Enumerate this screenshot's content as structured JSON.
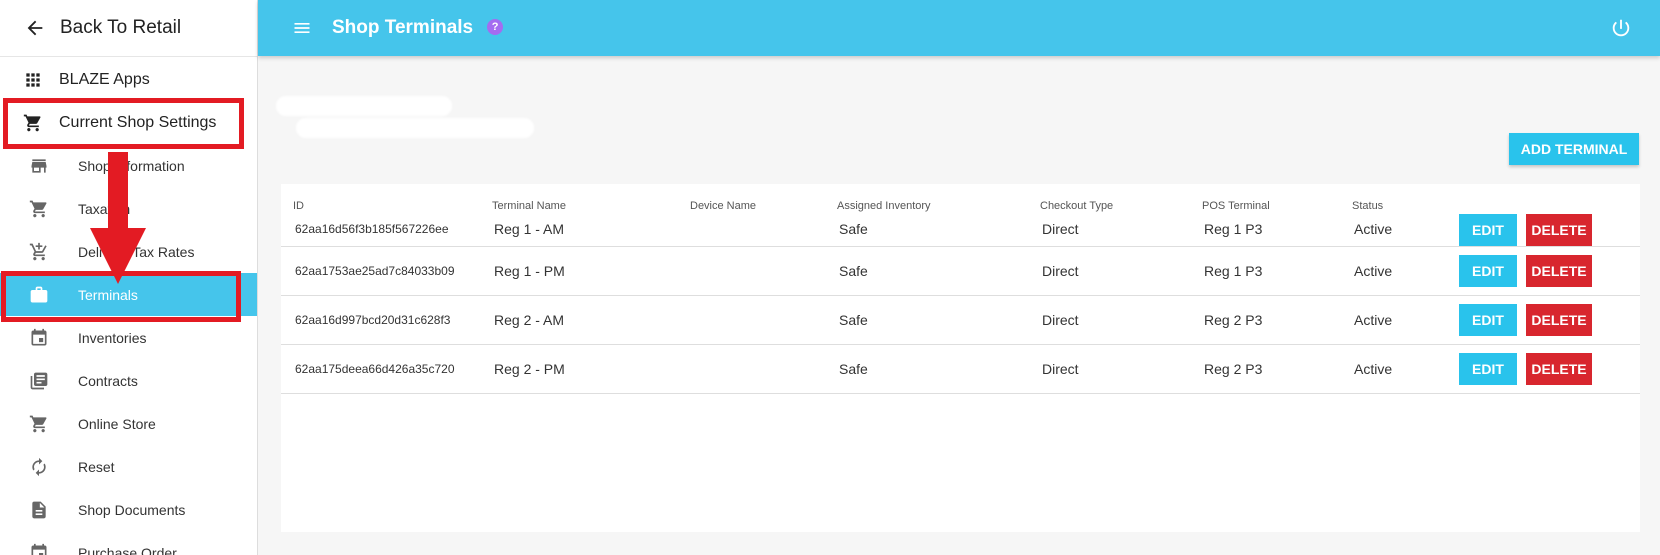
{
  "sidebar": {
    "back_label": "Back To Retail",
    "apps_label": "BLAZE Apps",
    "settings_label": "Current Shop Settings",
    "items": [
      {
        "label": "Shop Information",
        "icon": "store-icon"
      },
      {
        "label": "Taxation",
        "icon": "cart-icon"
      },
      {
        "label": "Delivery Tax Rates",
        "icon": "cart-plus-icon"
      },
      {
        "label": "Terminals",
        "icon": "briefcase-icon",
        "active": true
      },
      {
        "label": "Inventories",
        "icon": "calendar-icon"
      },
      {
        "label": "Contracts",
        "icon": "newspaper-icon"
      },
      {
        "label": "Online Store",
        "icon": "cart-icon"
      },
      {
        "label": "Reset",
        "icon": "refresh-icon"
      },
      {
        "label": "Shop Documents",
        "icon": "document-icon"
      },
      {
        "label": "Purchase Order",
        "icon": "calendar-icon"
      }
    ]
  },
  "header": {
    "title": "Shop Terminals",
    "help": "?"
  },
  "main": {
    "add_label": "ADD TERMINAL",
    "columns": [
      "ID",
      "Terminal Name",
      "Device Name",
      "Assigned Inventory",
      "Checkout Type",
      "POS Terminal",
      "Status"
    ],
    "rows": [
      {
        "id": "62aa16d56f3b185f567226ee",
        "name": "Reg 1 - AM",
        "device": "",
        "inventory": "Safe",
        "checkout": "Direct",
        "pos": "Reg 1 P3",
        "status": "Active"
      },
      {
        "id": "62aa1753ae25ad7c84033b09",
        "name": "Reg 1 - PM",
        "device": "",
        "inventory": "Safe",
        "checkout": "Direct",
        "pos": "Reg 1 P3",
        "status": "Active"
      },
      {
        "id": "62aa16d997bcd20d31c628f3",
        "name": "Reg 2 - AM",
        "device": "",
        "inventory": "Safe",
        "checkout": "Direct",
        "pos": "Reg 2 P3",
        "status": "Active"
      },
      {
        "id": "62aa175deea66d426a35c720",
        "name": "Reg 2 - PM",
        "device": "",
        "inventory": "Safe",
        "checkout": "Direct",
        "pos": "Reg 2 P3",
        "status": "Active"
      }
    ],
    "edit_label": "EDIT",
    "delete_label": "DELETE"
  },
  "colors": {
    "accent": "#45c5eb",
    "button": "#29c3ec",
    "danger": "#d8262e",
    "highlight": "#e31b23"
  }
}
